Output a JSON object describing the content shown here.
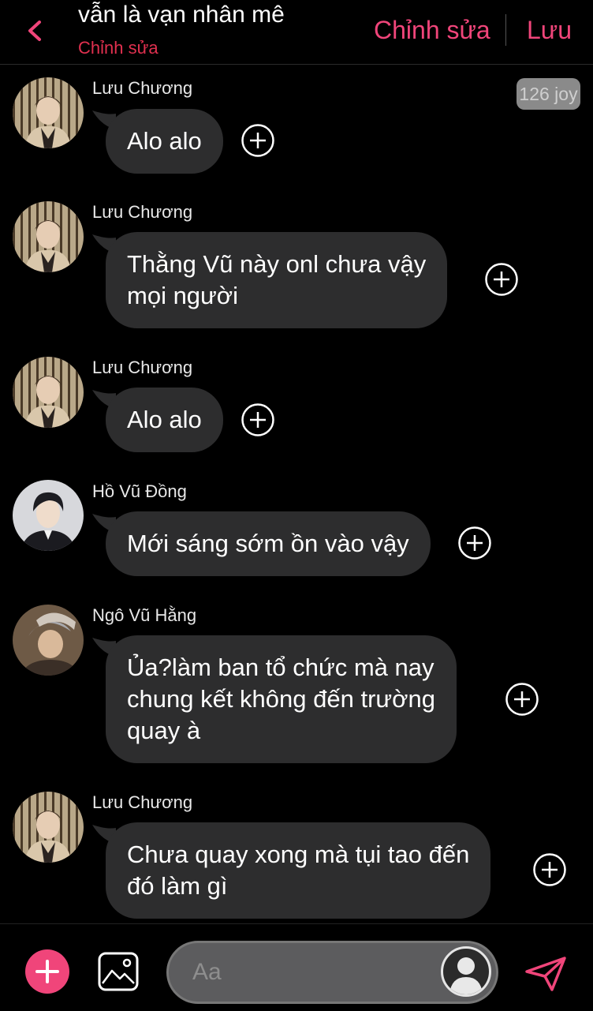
{
  "header": {
    "title": "vẫn là vạn nhân mê",
    "subtitle": "Chỉnh sửa",
    "edit_label": "Chỉnh sửa",
    "save_label": "Lưu",
    "accent_color": "#f0457a"
  },
  "joy_badge": "126 joy",
  "messages": [
    {
      "sender": "Lưu Chương",
      "lines": [
        "Alo alo"
      ]
    },
    {
      "sender": "Lưu Chương",
      "lines": [
        "Thằng Vũ này onl chưa vậy",
        "mọi người"
      ]
    },
    {
      "sender": "Lưu Chương",
      "lines": [
        "Alo alo"
      ]
    },
    {
      "sender": "Hồ Vũ Đồng",
      "lines": [
        "Mới sáng sớm ồn vào vậy"
      ]
    },
    {
      "sender": "Ngô Vũ Hằng",
      "lines": [
        "Ủa?làm ban tổ chức mà nay",
        "chung kết không đến trường",
        "quay à"
      ]
    },
    {
      "sender": "Lưu Chương",
      "lines": [
        "Chưa quay xong mà tụi tao đến",
        "đó làm gì"
      ]
    }
  ],
  "composer": {
    "placeholder": "Aa"
  },
  "icons": {
    "back": "chevron-left-icon",
    "add": "plus-icon",
    "image": "image-icon",
    "send": "send-icon",
    "reaction": "plus-circle-icon",
    "avatar": "user-avatar-icon"
  }
}
